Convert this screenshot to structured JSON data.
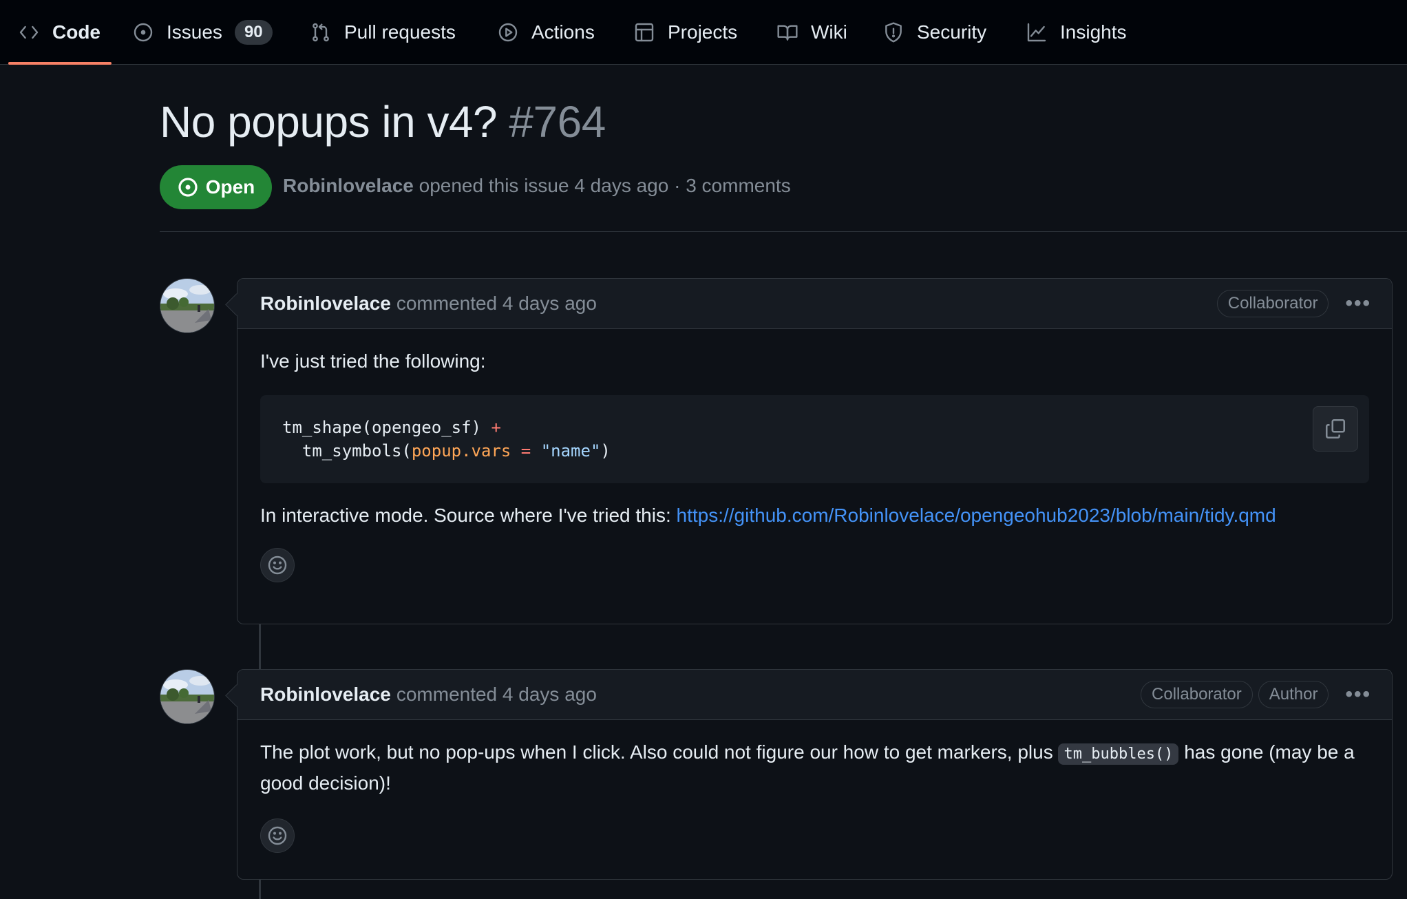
{
  "nav": {
    "tabs": [
      {
        "label": "Code",
        "icon": "code-icon",
        "active": true
      },
      {
        "label": "Issues",
        "icon": "issue-opened-icon",
        "counter": "90"
      },
      {
        "label": "Pull requests",
        "icon": "git-pull-request-icon"
      },
      {
        "label": "Actions",
        "icon": "play-icon"
      },
      {
        "label": "Projects",
        "icon": "table-icon"
      },
      {
        "label": "Wiki",
        "icon": "book-icon"
      },
      {
        "label": "Security",
        "icon": "shield-icon"
      },
      {
        "label": "Insights",
        "icon": "graph-icon"
      }
    ]
  },
  "issue": {
    "title": "No popups in v4?",
    "number": "#764",
    "state": "Open",
    "author": "Robinlovelace",
    "meta_text": "opened this issue 4 days ago · 3 comments"
  },
  "comments": [
    {
      "author": "Robinlovelace",
      "action": "commented 4 days ago",
      "roles": [
        "Collaborator"
      ],
      "intro": "I've just tried the following:",
      "code": {
        "l1_fn": "tm_shape(opengeo_sf) ",
        "l1_op": "+",
        "l2_fn": "  tm_symbols(",
        "l2_arg": "popup.vars",
        "l2_eq": " = ",
        "l2_str": "\"name\"",
        "l2_close": ")"
      },
      "source_text": "In interactive mode. Source where I've tried this: ",
      "source_link": "https://github.com/Robinlovelace/opengeohub2023/blob/main/tidy.qmd"
    },
    {
      "author": "Robinlovelace",
      "action": "commented 4 days ago",
      "roles": [
        "Collaborator",
        "Author"
      ],
      "text_before": "The plot work, but no pop-ups when I click. Also could not figure our how to get markers, plus ",
      "inline_code": "tm_bubbles()",
      "text_after": " has gone (may be a good decision)!"
    }
  ],
  "colors": {
    "background": "#0d1117",
    "open_badge": "#238636",
    "link": "#4493f8",
    "active_tab_underline": "#f78166"
  }
}
